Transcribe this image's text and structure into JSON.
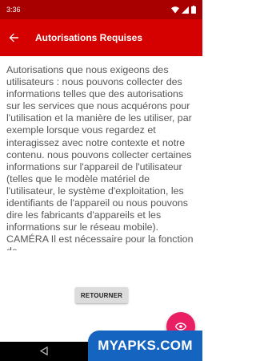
{
  "status_bar": {
    "time": "3:36",
    "icons": [
      "wifi-icon",
      "signal-icon",
      "battery-icon"
    ]
  },
  "app_bar": {
    "title": "Autorisations Requises",
    "back_icon": "arrow-back-icon"
  },
  "content": {
    "text": "Autorisations que nous exigeons des utilisateurs : nous pouvons collecter des informations telles que des autorisations sur les services que nous acquérons pour l'utilisation et la manière de les utiliser, par exemple lorsque vous regardez et interagissez avec notre contexte et notre contenu. nous pouvons collecter certaines informations sur l'appareil de l'utilisateur (telles que le modèle matériel de l'utilisateur, le système d'exploitation, les identifiants de l'appareil ou nous pouvons dire les fabricants d'appareils et les informations sur le réseau mobile). CAMÉRA Il est nécessaire pour la fonction de"
  },
  "buttons": {
    "return_label": "RETOURNER"
  },
  "fab": {
    "icon": "eye-icon",
    "color": "#e91e63"
  },
  "nav_bar": {
    "back_icon": "nav-back-triangle-icon"
  },
  "watermark": {
    "text": "MYAPKS.COM"
  },
  "colors": {
    "status_bar": "#a80000",
    "app_bar": "#d50000",
    "text": "#555555",
    "watermark_bg": "#1565c0"
  }
}
